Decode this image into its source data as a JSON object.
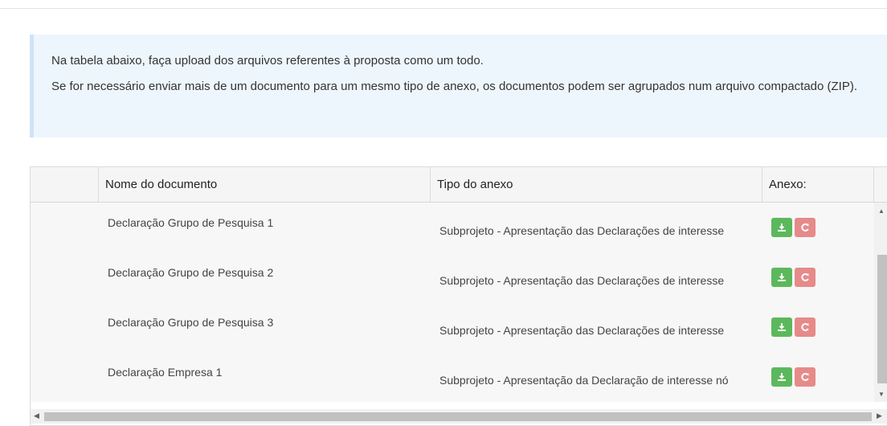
{
  "info": {
    "line1": "Na tabela abaixo, faça upload dos arquivos referentes à proposta como um todo.",
    "line2": "Se for necessário enviar mais de um documento para um mesmo tipo de anexo, os documentos podem ser agrupados num arquivo compactado (ZIP)."
  },
  "table": {
    "headers": {
      "empty": "",
      "name": "Nome do documento",
      "type": "Tipo do anexo",
      "attachment": "Anexo:"
    },
    "rows": [
      {
        "name": "Declaração Grupo de Pesquisa 1",
        "type": "Subprojeto - Apresentação das Declarações de interesse"
      },
      {
        "name": "Declaração Grupo de Pesquisa 2",
        "type": "Subprojeto - Apresentação das Declarações de interesse"
      },
      {
        "name": "Declaração Grupo de Pesquisa 3",
        "type": "Subprojeto - Apresentação das Declarações de interesse"
      },
      {
        "name": "Declaração Empresa 1",
        "type": "Subprojeto - Apresentação da Declaração de interesse nó"
      }
    ]
  },
  "icons": {
    "download": "download-icon",
    "replace": "replace-icon"
  },
  "colors": {
    "download_button": "#5cb85c",
    "replace_button": "#e68a8a",
    "info_background": "#eef6fd"
  }
}
